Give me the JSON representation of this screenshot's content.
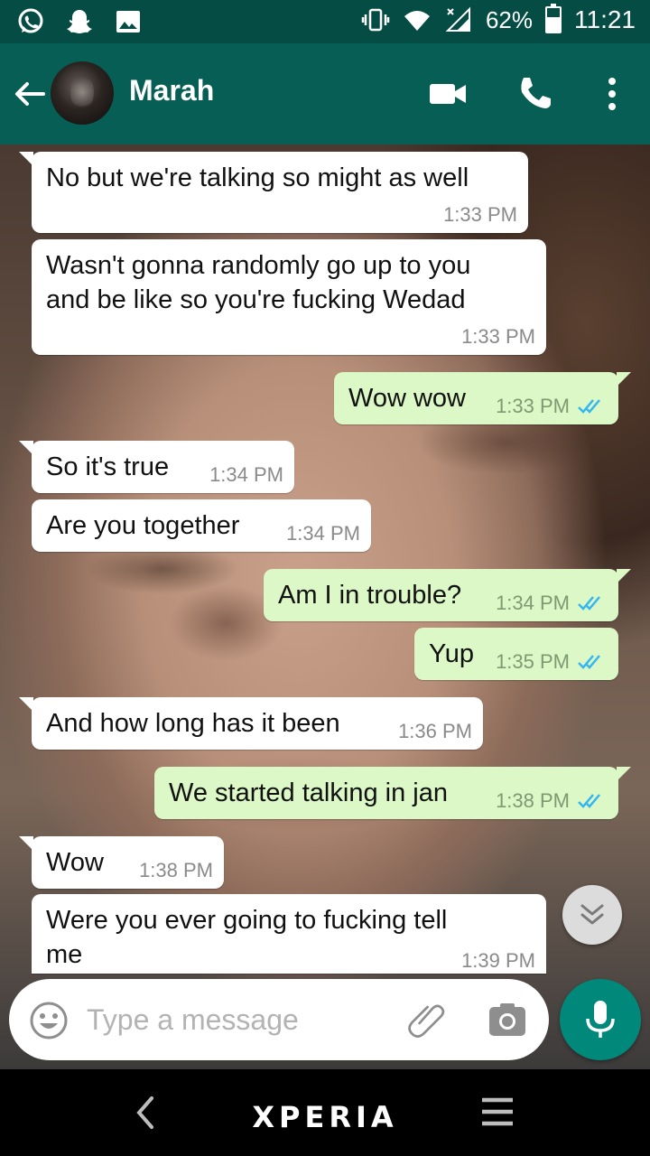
{
  "status_bar": {
    "battery_percent": "62%",
    "battery_level": 0.62,
    "time": "11:21",
    "left_icons": [
      "whatsapp-icon",
      "snapchat-icon",
      "gallery-icon"
    ],
    "right_icons": [
      "vibrate-icon",
      "wifi-icon",
      "signal-icon",
      "battery-icon"
    ]
  },
  "header": {
    "contact_name": "Marah",
    "icons": [
      "back-arrow-icon",
      "video-call-icon",
      "phone-icon",
      "more-vert-icon"
    ],
    "color": "#075e54"
  },
  "messages": [
    {
      "dir": "in",
      "text": "No but we're talking so might as well",
      "time": "1:33 PM"
    },
    {
      "dir": "in",
      "text": "Wasn't gonna randomly go up to you\nand be like so you're fucking Wedad",
      "time": "1:33 PM"
    },
    {
      "dir": "out",
      "text": "Wow wow",
      "time": "1:33 PM",
      "read": true
    },
    {
      "dir": "in",
      "text": "So it's true",
      "time": "1:34 PM"
    },
    {
      "dir": "in",
      "text": "Are you together",
      "time": "1:34 PM"
    },
    {
      "dir": "out",
      "text": "Am I in trouble?",
      "time": "1:34 PM",
      "read": true
    },
    {
      "dir": "out",
      "text": "Yup",
      "time": "1:35 PM",
      "read": true
    },
    {
      "dir": "in",
      "text": "And how long has it been",
      "time": "1:36 PM"
    },
    {
      "dir": "out",
      "text": "We started talking in jan",
      "time": "1:38 PM",
      "read": true
    },
    {
      "dir": "in",
      "text": "Wow",
      "time": "1:38 PM"
    },
    {
      "dir": "in",
      "text": "Were you ever going to fucking tell\nme",
      "time": "1:39 PM"
    }
  ],
  "composer": {
    "placeholder": "Type a message",
    "icons": [
      "emoji-icon",
      "attach-icon",
      "camera-icon",
      "mic-icon"
    ]
  },
  "nav_bar": {
    "brand": "XPERIA"
  },
  "colors": {
    "incoming_bubble": "#ffffff",
    "outgoing_bubble": "#dcf8c6",
    "read_ticks": "#34b7f1",
    "mic_button": "#00897b"
  }
}
